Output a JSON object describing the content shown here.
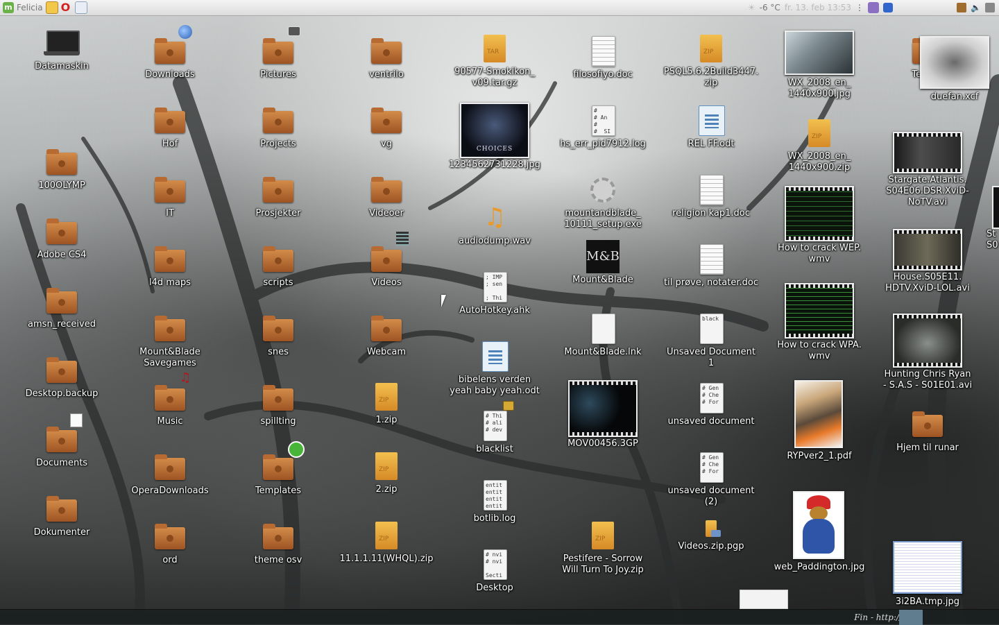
{
  "panel_top": {
    "user": "Felicia",
    "weather": "-6 °C",
    "clock": "fr. 13. feb 13:53",
    "icons": [
      "mint-menu-icon",
      "notes-icon",
      "opera-icon",
      "mail-icon",
      "settings-icon",
      "network-bars-icon",
      "battery-icon",
      "volume-icon"
    ]
  },
  "panel_bottom": {
    "signature": "Fin - http://"
  },
  "desktop": {
    "col1": [
      {
        "label": "Datamaskin",
        "icon": "computer-icon"
      },
      {
        "label": "100OLYMP",
        "icon": "folder-icon"
      },
      {
        "label": "Adobe CS4",
        "icon": "folder-icon"
      },
      {
        "label": "amsn_received",
        "icon": "folder-icon"
      },
      {
        "label": "Desktop.backup",
        "icon": "folder-icon"
      },
      {
        "label": "Documents",
        "icon": "folder-icon"
      },
      {
        "label": "Dokumenter",
        "icon": "folder-icon"
      }
    ],
    "col2": [
      {
        "label": "Downloads",
        "icon": "folder-icon"
      },
      {
        "label": "Hof",
        "icon": "folder-icon"
      },
      {
        "label": "IT",
        "icon": "folder-icon"
      },
      {
        "label": "l4d maps",
        "icon": "folder-icon"
      },
      {
        "label": "Mount&Blade\nSavegames",
        "icon": "folder-icon"
      },
      {
        "label": "Music",
        "icon": "folder-icon"
      },
      {
        "label": "OperaDownloads",
        "icon": "folder-icon"
      },
      {
        "label": "ord",
        "icon": "folder-icon"
      }
    ],
    "col3": [
      {
        "label": "Pictures",
        "icon": "folder-icon"
      },
      {
        "label": "Projects",
        "icon": "folder-icon"
      },
      {
        "label": "Prosjekter",
        "icon": "folder-icon"
      },
      {
        "label": "scripts",
        "icon": "folder-icon"
      },
      {
        "label": "snes",
        "icon": "folder-icon"
      },
      {
        "label": "spillting",
        "icon": "folder-icon"
      },
      {
        "label": "Templates",
        "icon": "folder-icon"
      },
      {
        "label": "theme osv",
        "icon": "folder-icon"
      }
    ],
    "col4": [
      {
        "label": "ventrilo",
        "icon": "folder-icon"
      },
      {
        "label": "vg",
        "icon": "folder-icon"
      },
      {
        "label": "Videoer",
        "icon": "folder-icon"
      },
      {
        "label": "Videos",
        "icon": "folder-icon"
      },
      {
        "label": "Webcam",
        "icon": "folder-icon"
      },
      {
        "label": "1.zip",
        "icon": "zip-icon"
      },
      {
        "label": "2.zip",
        "icon": "zip-icon"
      },
      {
        "label": "11.1.1.11(WHQL).zip",
        "icon": "zip-icon"
      }
    ],
    "col5": [
      {
        "label": "90577-Smokikon_\nv09.tar.gz",
        "icon": "archive-icon"
      },
      {
        "label": "1234562731228.jpg",
        "icon": "image-thumbnail-icon"
      },
      {
        "label": "audiodump.wav",
        "icon": "audio-icon"
      },
      {
        "label": "AutoHotkey.ahk",
        "icon": "script-icon",
        "text": "; IMP\n; sen\n\n; Thi"
      },
      {
        "label": "bibelens verden\nyeah baby yeah.odt",
        "icon": "odt-icon"
      },
      {
        "label": "blacklist",
        "icon": "text-icon",
        "text": "# Thi\n# ali\n# dev"
      },
      {
        "label": "botlib.log",
        "icon": "text-icon",
        "text": "entit\nentit\nentit\nentit"
      },
      {
        "label": "Desktop",
        "icon": "text-icon",
        "text": "# nvi\n# nvi\n\nSecti"
      }
    ],
    "col6": [
      {
        "label": "filosofiyo.doc",
        "icon": "doc-icon"
      },
      {
        "label": "hs_err_pid7912.log",
        "icon": "text-icon",
        "text": "#\n# An\n#\n#  SI"
      },
      {
        "label": "mountandblade_\n10111_setup.exe",
        "icon": "gear-icon"
      },
      {
        "label": "Mount&Blade",
        "icon": "mount-blade-logo-icon",
        "logo": "M&B"
      },
      {
        "label": "Mount&Blade.lnk",
        "icon": "file-icon"
      },
      {
        "label": "MOV00456.3GP",
        "icon": "video-thumbnail-icon"
      },
      {
        "label": "Pestifere - Sorrow\nWill Turn To Joy.zip",
        "icon": "zip-icon"
      }
    ],
    "col7": [
      {
        "label": "PSQL5.6.2Build3447.\nzip",
        "icon": "zip-icon"
      },
      {
        "label": "REL FF.odt",
        "icon": "odt-icon"
      },
      {
        "label": "religion kap1.doc",
        "icon": "doc-icon"
      },
      {
        "label": "til prøve, notater.doc",
        "icon": "doc-icon"
      },
      {
        "label": "Unsaved Document\n1",
        "icon": "text-icon",
        "text": "black"
      },
      {
        "label": "unsaved document",
        "icon": "text-icon",
        "text": "# Gen\n# Che\n# For"
      },
      {
        "label": "unsaved document\n(2)",
        "icon": "text-icon",
        "text": "# Gen\n# Che\n# For"
      },
      {
        "label": "Videos.zip.pgp",
        "icon": "pgp-icon"
      }
    ],
    "col8": [
      {
        "label": "WX_2008_en_\n1440x900.jpg",
        "icon": "image-thumbnail-icon"
      },
      {
        "label": "WX_2008_en_\n1440x900.zip",
        "icon": "zip-icon"
      },
      {
        "label": "How to crack WEP.\nwmv",
        "icon": "video-thumbnail-icon"
      },
      {
        "label": "How to crack WPA.\nwmv",
        "icon": "video-thumbnail-icon"
      },
      {
        "label": "RYPver2_1.pdf",
        "icon": "pdf-thumbnail-icon"
      },
      {
        "label": "web_Paddington.jpg",
        "icon": "image-thumbnail-icon"
      }
    ],
    "col9": [
      {
        "label": "Techno",
        "icon": "folder-icon"
      },
      {
        "label": "duefan.xcf",
        "icon": "image-thumbnail-icon"
      },
      {
        "label": "Stargate.Atlantis.\nS04E06.DSR.XviD-\nNoTV.avi",
        "icon": "video-thumbnail-icon"
      },
      {
        "label": "House.S05E11.\nHDTV.XviD-LOL.avi",
        "icon": "video-thumbnail-icon"
      },
      {
        "label": "Hunting Chris Ryan\n- S.A.S - S01E01.avi",
        "icon": "video-thumbnail-icon"
      },
      {
        "label": "Hjem til runar",
        "icon": "home-folder-icon"
      },
      {
        "label": "3i2BA.tmp.jpg",
        "icon": "image-thumbnail-icon"
      }
    ],
    "col10": [
      {
        "label": "St\nS0",
        "icon": "video-thumbnail-icon"
      }
    ]
  },
  "thumbnail_texts": {
    "choices": "CHOICES"
  }
}
